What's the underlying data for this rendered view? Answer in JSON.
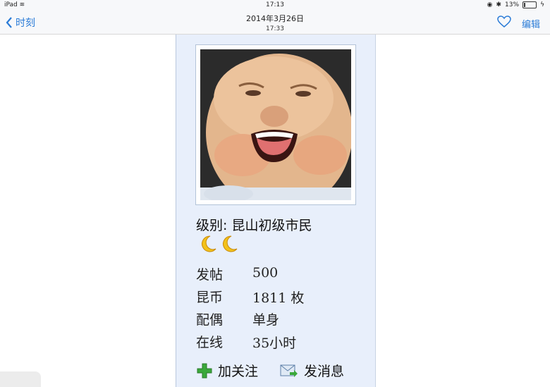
{
  "status_bar": {
    "device": "iPad",
    "time": "17:13",
    "battery": "13%",
    "battery_level": 0.13
  },
  "nav": {
    "back_label": "时刻",
    "title_date": "2014年3月26日",
    "title_time": "17:33",
    "edit_label": "编辑"
  },
  "profile": {
    "level_label": "级别: 昆山初级市民",
    "stats": [
      {
        "label": "发帖",
        "value": "500"
      },
      {
        "label": "昆币",
        "value": "1811 枚"
      },
      {
        "label": "配偶",
        "value": "单身"
      },
      {
        "label": "在线",
        "value": "35小时"
      }
    ],
    "actions": {
      "follow": "加关注",
      "message": "发消息"
    }
  },
  "colors": {
    "accent": "#2a7bd7",
    "panel": "#e8effb",
    "plus": "#3aa83a"
  }
}
